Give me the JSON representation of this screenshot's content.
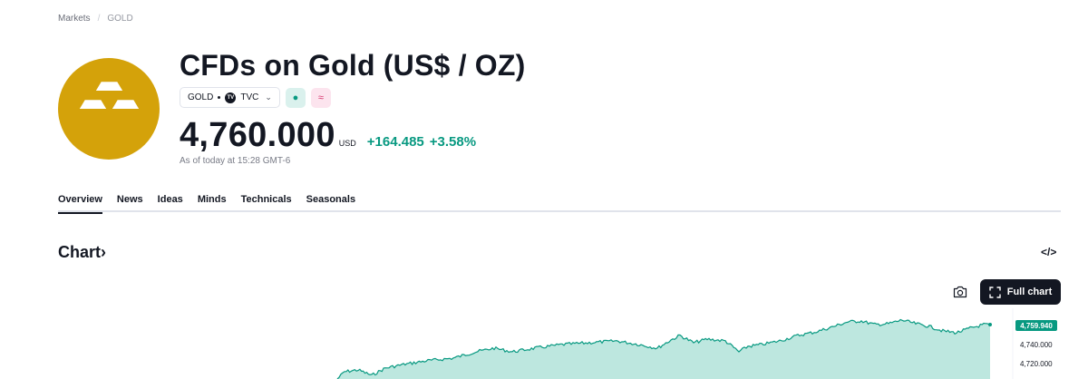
{
  "breadcrumb": {
    "root": "Markets",
    "separator": "/",
    "current": "GOLD"
  },
  "instrument": {
    "title": "CFDs on Gold (US$ / OZ)",
    "symbol": "GOLD",
    "exchange": "TVC",
    "exchange_icon": "TV",
    "market_status_icon": "●",
    "derived_icon": "≈",
    "price": "4,760.000",
    "currency": "USD",
    "change_abs": "+164.485",
    "change_pct": "+3.58%",
    "as_of": "As of today at 15:28 GMT-6"
  },
  "tabs": [
    {
      "label": "Overview",
      "active": true
    },
    {
      "label": "News"
    },
    {
      "label": "Ideas"
    },
    {
      "label": "Minds"
    },
    {
      "label": "Technicals"
    },
    {
      "label": "Seasonals"
    }
  ],
  "chart_section": {
    "title": "Chart",
    "title_chevron": "›",
    "embed_icon": "</>",
    "full_chart_label": "Full chart",
    "current_price_label": "4,759.940",
    "axis_labels": [
      "4,740.000",
      "4,720.000"
    ]
  },
  "colors": {
    "up": "#089981",
    "logo_bg": "#d4a20a",
    "fill": "#b2e3d9"
  }
}
